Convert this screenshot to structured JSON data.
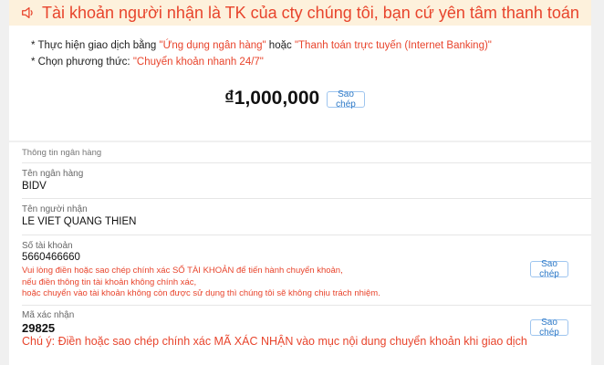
{
  "banner": {
    "icon": "speaker-icon",
    "text": "Tài khoản người nhận là TK của cty chúng tôi, bạn cứ yên tâm thanh toán",
    "color": "#e8442c",
    "background": "#fdf1dc"
  },
  "instructions": {
    "line1": {
      "prefix": "* Thực hiện giao dịch bằng ",
      "method1": "\"Ứng dụng ngân hàng\"",
      "connector": " hoặc ",
      "method2": "\"Thanh toán trực tuyến (Internet Banking)\""
    },
    "line2": {
      "prefix": "* Chọn phương thức: ",
      "method": "\"Chuyển khoản nhanh 24/7\""
    }
  },
  "payment": {
    "amount": "₫1,000,000",
    "copy_label": "Sao chép"
  },
  "bank_info": {
    "section_title": "Thông tin ngân hàng",
    "bank_name": {
      "label": "Tên ngân hàng",
      "value": "BIDV"
    },
    "recipient": {
      "label": "Tên người nhận",
      "value": "LE VIET QUANG THIEN"
    },
    "account": {
      "label": "Số tài khoản",
      "value": "5660466660",
      "warnings": [
        "Vui lòng điền hoặc sao chép chính xác SỐ TÀI KHOẢN để tiến hành chuyển khoản,",
        "nếu điền thông tin tài khoản không chính xác,",
        "hoặc chuyển vào tài khoản không còn được sử dụng thì chúng tôi sẽ không chịu trách nhiệm."
      ],
      "copy_label": "Sao chép"
    },
    "confirmation_code": {
      "label": "Mã xác nhận",
      "value": "29825",
      "warning": "Chú ý: Điền hoặc sao chép chính xác MÃ XÁC NHẬN vào mục nội dung chuyển khoản khi giao dịch",
      "copy_label": "Sao chép"
    }
  },
  "colors": {
    "accent_red": "#e8442c",
    "link_blue": "#2d79c7",
    "page_background": "#f0f0f0"
  }
}
